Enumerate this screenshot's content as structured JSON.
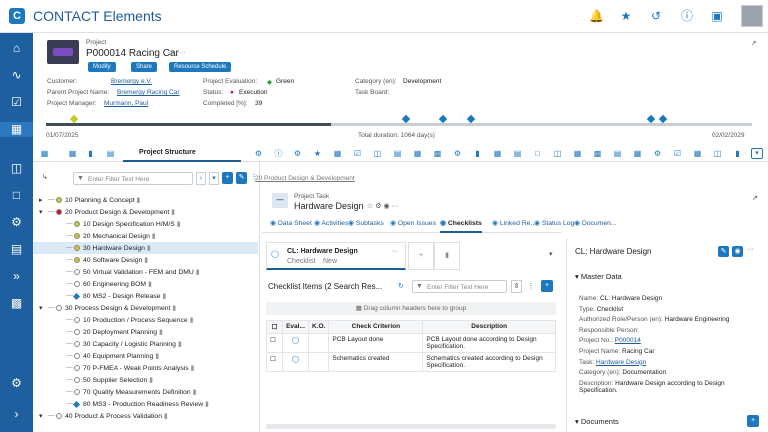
{
  "app": {
    "title": "CONTACT Elements"
  },
  "header": {
    "type_label": "Project",
    "title": "P000014 Racing Car",
    "buttons": [
      "Modify",
      "Share",
      "Resource Schedule"
    ],
    "fields": {
      "customer_label": "Customer:",
      "customer": "Bremergy e.V.",
      "parent_label": "Parent Project Name:",
      "parent": "Bremergy Racing Car",
      "manager_label": "Project Manager:",
      "manager": "Murmann, Paul",
      "evaluation_label": "Project Evaluation:",
      "evaluation": "Green",
      "status_label": "Status:",
      "status": "Execution",
      "completed_label": "Completed [%]:",
      "completed": "39",
      "category_label": "Category (en):",
      "category": "Development",
      "taskboard_label": "Task Board:"
    },
    "timeline": {
      "start": "01/07/2025",
      "end": "02/02/2029",
      "duration": "Total duration: 1064 day(s)"
    }
  },
  "main_tabs": {
    "active": "Project Structure"
  },
  "tree": {
    "filter_placeholder": "Enter Filter Text Here",
    "rows": [
      {
        "label": "10 Planning & Concept",
        "indent": 0,
        "status": "#c7c92a"
      },
      {
        "label": "20 Product Design & Development",
        "indent": 0,
        "status": "#c0182a"
      },
      {
        "label": "10 Design Specification H/M/S",
        "indent": 1,
        "status": "#c7c92a"
      },
      {
        "label": "20 Mechanical Design",
        "indent": 1,
        "status": "#c7c92a"
      },
      {
        "label": "30 Hardware Design",
        "indent": 1,
        "status": "#c7c92a",
        "selected": true
      },
      {
        "label": "40 Software Design",
        "indent": 1,
        "status": "#c7c92a"
      },
      {
        "label": "50 Virtual Validation - FEM and DMU",
        "indent": 1,
        "status": "#fff"
      },
      {
        "label": "60 Engineering BOM",
        "indent": 1,
        "status": "#fff"
      },
      {
        "label": "80 MS2 - Design Release",
        "indent": 1,
        "status": "diamond"
      },
      {
        "label": "30 Process Design & Development",
        "indent": 0,
        "status": "#fff"
      },
      {
        "label": "10 Production / Process Sequence",
        "indent": 1,
        "status": "#fff"
      },
      {
        "label": "20 Deployment Planning",
        "indent": 1,
        "status": "#fff"
      },
      {
        "label": "30 Capacity / Logistic Planning",
        "indent": 1,
        "status": "#fff"
      },
      {
        "label": "40 Equipment Planning",
        "indent": 1,
        "status": "#fff"
      },
      {
        "label": "70 P-FMEA - Weak Points Analysis",
        "indent": 1,
        "status": "#fff"
      },
      {
        "label": "50 Supplier Selection",
        "indent": 1,
        "status": "#fff"
      },
      {
        "label": "70 Quality Measurements Definition",
        "indent": 1,
        "status": "#fff"
      },
      {
        "label": "80 MS3 - Production Readiness Review",
        "indent": 1,
        "status": "diamond"
      },
      {
        "label": "40 Product & Process Validation",
        "indent": 0,
        "status": "#fff"
      }
    ]
  },
  "task": {
    "breadcrumb": "20 Product Design & Development",
    "type_label": "Project Task",
    "title": "Hardware Design",
    "tabs": [
      "Data Sheet",
      "Activities",
      "Subtasks",
      "Open Issues",
      "Checklists",
      "Linked Re...",
      "Status Log",
      "Documen..."
    ],
    "active_tab": "Checklists",
    "checklist_card": {
      "title": "CL: Hardware Design",
      "subtitle": "Checklist",
      "status": "New"
    },
    "items_title": "Checklist Items (2 Search Res...",
    "filter_placeholder": "Enter Filter Text Here",
    "group_hint": "Drag column headers here to group",
    "columns": [
      "Eval...",
      "K.O.",
      "Check Criterion",
      "Description"
    ],
    "rows": [
      {
        "criterion": "PCB Layout done",
        "description": "PCB Layout done according to Design Specification."
      },
      {
        "criterion": "Schematics created",
        "description": "Schematics created according to Design Specification."
      }
    ]
  },
  "detail": {
    "title": "CL: Hardware Design",
    "section": "Master Data",
    "fields": [
      {
        "label": "Name:",
        "value": "CL: Hardware Design"
      },
      {
        "label": "Type:",
        "value": "Checklist"
      },
      {
        "label": "Authorized Role/Person (en):",
        "value": "Hardware Engineering"
      },
      {
        "label": "Responsible Person:",
        "value": ""
      },
      {
        "label": "Project No.:",
        "value": "P000014",
        "link": true
      },
      {
        "label": "Project Name:",
        "value": "Racing Car"
      },
      {
        "label": "Task:",
        "value": "Hardware Design",
        "link": true
      },
      {
        "label": "Category (en):",
        "value": "Documentation"
      },
      {
        "label": "Description:",
        "value": "Hardware Design according to Design Specification."
      }
    ],
    "documents": "Documents"
  }
}
